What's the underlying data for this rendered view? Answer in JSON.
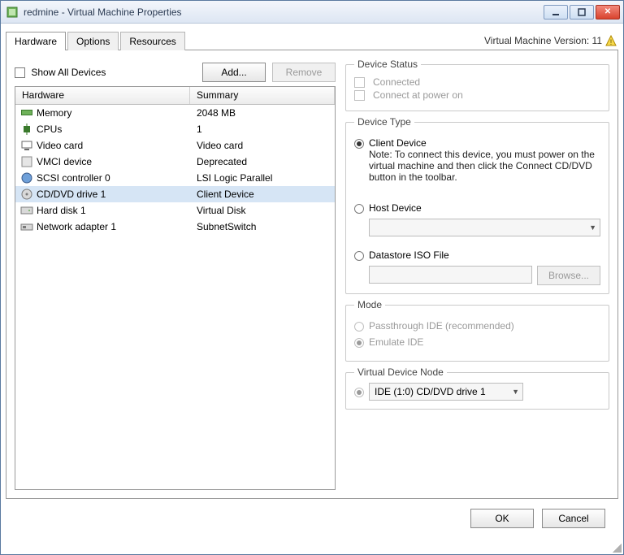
{
  "title": "redmine - Virtual Machine Properties",
  "version_label": "Virtual Machine Version: 11",
  "tabs": [
    {
      "label": "Hardware",
      "active": true
    },
    {
      "label": "Options",
      "active": false
    },
    {
      "label": "Resources",
      "active": false
    }
  ],
  "left": {
    "show_all_label": "Show All Devices",
    "add_label": "Add...",
    "remove_label": "Remove",
    "columns": {
      "hw": "Hardware",
      "summary": "Summary"
    },
    "rows": [
      {
        "icon": "memory-icon",
        "name": "Memory",
        "summary": "2048 MB",
        "selected": false
      },
      {
        "icon": "cpu-icon",
        "name": "CPUs",
        "summary": "1",
        "selected": false
      },
      {
        "icon": "video-icon",
        "name": "Video card",
        "summary": "Video card",
        "selected": false
      },
      {
        "icon": "vmci-icon",
        "name": "VMCI device",
        "summary": "Deprecated",
        "selected": false
      },
      {
        "icon": "scsi-icon",
        "name": "SCSI controller 0",
        "summary": "LSI Logic Parallel",
        "selected": false
      },
      {
        "icon": "cddvd-icon",
        "name": "CD/DVD drive 1",
        "summary": "Client Device",
        "selected": true
      },
      {
        "icon": "disk-icon",
        "name": "Hard disk 1",
        "summary": "Virtual Disk",
        "selected": false
      },
      {
        "icon": "nic-icon",
        "name": "Network adapter 1",
        "summary": "SubnetSwitch",
        "selected": false
      }
    ]
  },
  "right": {
    "device_status": {
      "legend": "Device Status",
      "connected_label": "Connected",
      "connect_power_label": "Connect at power on"
    },
    "device_type": {
      "legend": "Device Type",
      "client_label": "Client Device",
      "client_note": "Note: To connect this device, you must power on the virtual machine and then click the Connect CD/DVD button in the toolbar.",
      "host_label": "Host Device",
      "host_value": "",
      "datastore_label": "Datastore ISO File",
      "datastore_value": "",
      "browse_label": "Browse..."
    },
    "mode": {
      "legend": "Mode",
      "passthrough_label": "Passthrough IDE (recommended)",
      "emulate_label": "Emulate IDE"
    },
    "vdn": {
      "legend": "Virtual Device Node",
      "value": "IDE (1:0) CD/DVD drive 1"
    }
  },
  "footer": {
    "ok": "OK",
    "cancel": "Cancel"
  }
}
